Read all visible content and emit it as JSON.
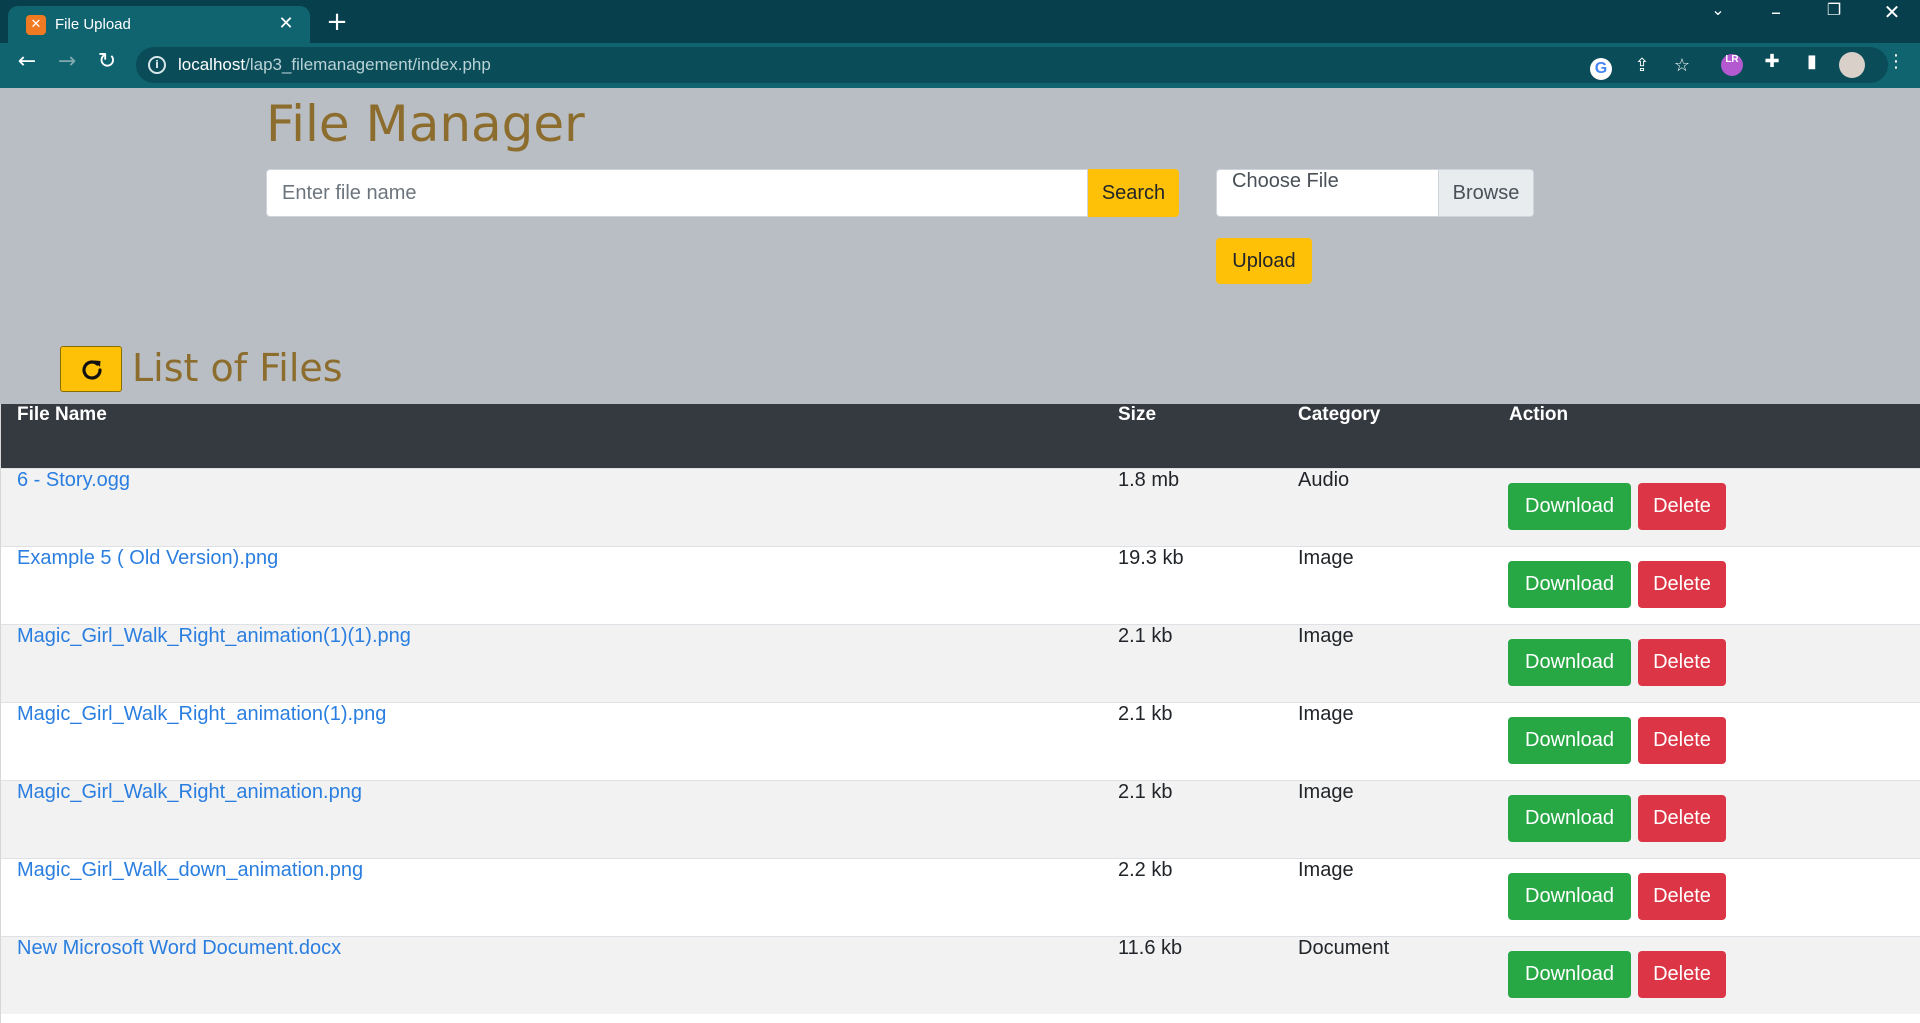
{
  "browser": {
    "tab_title": "File Upload",
    "tab_favicon": "xampp-favicon-icon",
    "new_tab": "+",
    "url_host": "localhost",
    "url_path": "/lap3_filemanagement/index.php"
  },
  "page": {
    "title": "File Manager",
    "search": {
      "placeholder": "Enter file name",
      "button": "Search"
    },
    "upload": {
      "file_label": "Choose File",
      "browse": "Browse",
      "button": "Upload"
    },
    "list_title": "List of Files"
  },
  "table": {
    "headers": {
      "name": "File Name",
      "size": "Size",
      "category": "Category",
      "action": "Action"
    },
    "rows": [
      {
        "name": "6 - Story.ogg",
        "size": "1.8 mb",
        "category": "Audio",
        "download": "Download",
        "delete": "Delete"
      },
      {
        "name": "Example 5 ( Old Version).png",
        "size": "19.3 kb",
        "category": "Image",
        "download": "Download",
        "delete": "Delete"
      },
      {
        "name": "Magic_Girl_Walk_Right_animation(1)(1).png",
        "size": "2.1 kb",
        "category": "Image",
        "download": "Download",
        "delete": "Delete"
      },
      {
        "name": "Magic_Girl_Walk_Right_animation(1).png",
        "size": "2.1 kb",
        "category": "Image",
        "download": "Download",
        "delete": "Delete"
      },
      {
        "name": "Magic_Girl_Walk_Right_animation.png",
        "size": "2.1 kb",
        "category": "Image",
        "download": "Download",
        "delete": "Delete"
      },
      {
        "name": "Magic_Girl_Walk_down_animation.png",
        "size": "2.2 kb",
        "category": "Image",
        "download": "Download",
        "delete": "Delete"
      },
      {
        "name": "New Microsoft Word Document.docx",
        "size": "11.6 kb",
        "category": "Document",
        "download": "Download",
        "delete": "Delete"
      }
    ]
  },
  "colors": {
    "title": "#8d6d2e",
    "warning": "#ffc107",
    "success": "#28a745",
    "danger": "#dc3545",
    "link": "#2a7ee0",
    "table_header": "#343a40"
  }
}
